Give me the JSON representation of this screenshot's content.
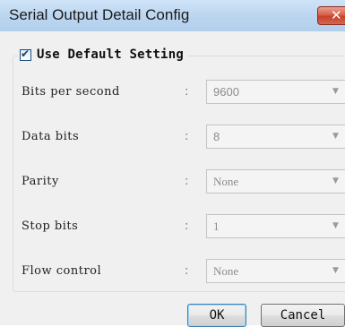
{
  "window": {
    "title": "Serial Output Detail Config",
    "close_glyph": "✕"
  },
  "use_default": {
    "label": "Use Default Setting",
    "checked": true
  },
  "fields": [
    {
      "label": "Bits per second",
      "value": "9600"
    },
    {
      "label": "Data bits",
      "value": "8"
    },
    {
      "label": "Parity",
      "value": "None"
    },
    {
      "label": "Stop bits",
      "value": "1"
    },
    {
      "label": "Flow control",
      "value": "None"
    }
  ],
  "separator": ":",
  "buttons": {
    "ok": "OK",
    "cancel": "Cancel"
  },
  "colors": {
    "titlebar": "#bcd6f0",
    "close_button": "#c7402a",
    "dialog_background": "#f0f0f0",
    "disabled_text": "#8c8c8c"
  },
  "icons": {
    "close": "close-icon",
    "dropdown": "chevron-down-icon",
    "checkbox": "checkmark-icon"
  }
}
